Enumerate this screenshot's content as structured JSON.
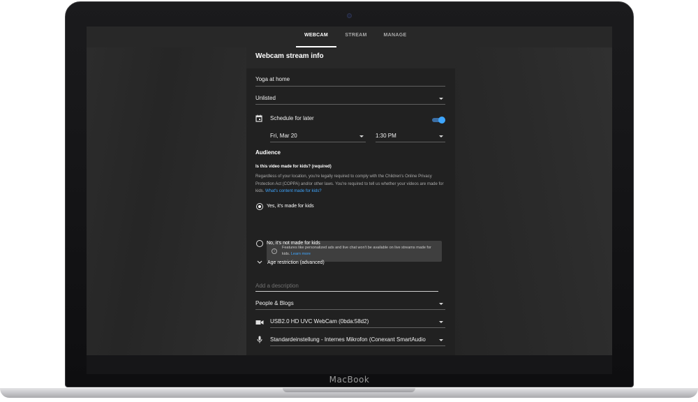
{
  "device": {
    "brand": "MacBook"
  },
  "tabs": [
    {
      "label": "WEBCAM",
      "active": true
    },
    {
      "label": "STREAM",
      "active": false
    },
    {
      "label": "MANAGE",
      "active": false
    }
  ],
  "panel": {
    "title": "Webcam stream info",
    "title_field": {
      "value": "Yoga at home"
    },
    "visibility": {
      "value": "Unlisted"
    },
    "schedule": {
      "label": "Schedule for later",
      "enabled": true,
      "date": "Fri, Mar 20",
      "time": "1:30 PM"
    },
    "audience": {
      "heading": "Audience",
      "question": "Is this video made for kids? (required)",
      "explanation": "Regardless of your location, you're legally required to comply with the Children's Online Privacy Protection Act (COPPA) and/or other laws. You're required to tell us whether your videos are made for kids.",
      "explanation_link": "What's content made for kids?",
      "option_yes": "Yes, it's made for kids",
      "option_no": "No, it's not made for kids",
      "selected": "yes",
      "info_text": "Features like personalized ads and live chat won't be available on live streams made for kids.",
      "info_link": "Learn more",
      "age_restriction": "Age restriction (advanced)"
    },
    "description": {
      "placeholder": "Add a description",
      "value": ""
    },
    "category": {
      "value": "People & Blogs"
    },
    "camera": {
      "value": "USB2.0 HD UVC WebCam (0bda:58d2)"
    },
    "microphone": {
      "value": "Standardeinstellung - Internes Mikrofon (Conexant SmartAudio"
    }
  },
  "colors": {
    "accent": "#3ea6ff",
    "panel_bg": "#212121",
    "screen_bg": "#2a2a2a"
  }
}
